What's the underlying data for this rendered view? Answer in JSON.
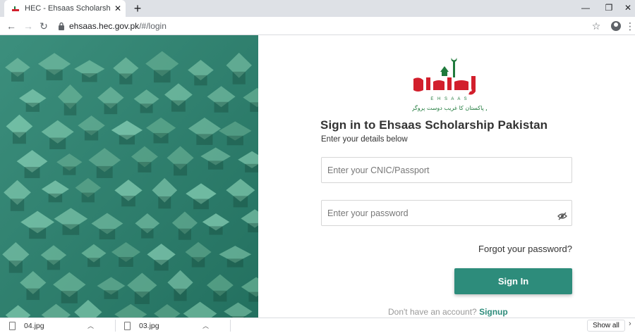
{
  "browser": {
    "tab_title": "HEC - Ehsaas Scholarship Pakistan",
    "tab_close": "✕",
    "new_tab": "+",
    "url_host": "ehsaas.hec.gov.pk",
    "url_path": "/#/login",
    "window_controls": [
      "—",
      "❐",
      "✕"
    ]
  },
  "logo": {
    "word": "احساس",
    "latin": "E H S A A S",
    "tagline": "نئے پاکستان کا غریب دوست پروگرام",
    "colors": {
      "red": "#d21f2c",
      "green": "#1f7a3c"
    }
  },
  "login": {
    "heading": "Sign in to Ehsaas Scholarship Pakistan",
    "subheading": "Enter your details below",
    "cnic_placeholder": "Enter your CNIC/Passport",
    "password_placeholder": "Enter your password",
    "forgot": "Forgot your password?",
    "signin_label": "Sign In",
    "no_account": "Don't have an account?",
    "signup_label": "Signup"
  },
  "theme": {
    "accent": "#2d8c7b",
    "hero": "#2d8170"
  },
  "downloads": {
    "items": [
      {
        "name": "04.jpg"
      },
      {
        "name": "03.jpg"
      }
    ],
    "show_all": "Show all"
  }
}
